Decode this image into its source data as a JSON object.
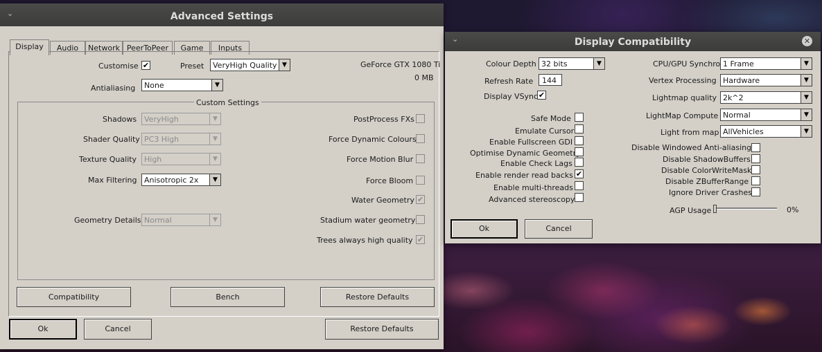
{
  "adv": {
    "title": "Advanced Settings",
    "tabs": [
      "Display",
      "Audio",
      "Network",
      "PeerToPeer",
      "Game",
      "Inputs"
    ],
    "gpu_name": "GeForce GTX 1080 Ti",
    "gpu_mem": "0 MB",
    "customise_label": "Customise",
    "customise_checked": "✔",
    "preset_label": "Preset",
    "preset_value": "VeryHigh Quality",
    "aa_label": "Antialiasing",
    "aa_value": "None",
    "group_title": "Custom Settings",
    "shadows_label": "Shadows",
    "shadows_value": "VeryHigh",
    "shader_label": "Shader Quality",
    "shader_value": "PC3 High",
    "texture_label": "Texture Quality",
    "texture_value": "High",
    "maxfilter_label": "Max Filtering",
    "maxfilter_value": "Anisotropic  2x",
    "geometry_label": "Geometry Details",
    "geometry_value": "Normal",
    "postfx_label": "PostProcess FXs",
    "dyncol_label": "Force Dynamic Colours",
    "motionblur_label": "Force Motion Blur",
    "bloom_label": "Force Bloom",
    "water_label": "Water Geometry",
    "water_checked": "✔",
    "stadium_label": "Stadium water geometry",
    "trees_label": "Trees always high quality",
    "trees_checked": "✔",
    "btn_compat": "Compatibility",
    "btn_bench": "Bench",
    "btn_restore_inner": "Restore Defaults",
    "btn_ok": "Ok",
    "btn_cancel": "Cancel",
    "btn_restore": "Restore Defaults"
  },
  "compat": {
    "title": "Display Compatibility",
    "colour_depth_label": "Colour Depth",
    "colour_depth_value": "32 bits",
    "refresh_label": "Refresh Rate",
    "refresh_value": "144",
    "vsync_label": "Display VSync",
    "vsync_checked": "✔",
    "safe_mode": "Safe Mode",
    "emulate_cursor": "Emulate Cursor",
    "fullscreen_gdi": "Enable Fullscreen GDI",
    "opt_dyn_geom": "Optimise Dynamic Geometry",
    "check_lags": "Enable Check Lags",
    "render_readbacks": "Enable render read backs",
    "render_readbacks_checked": "✔",
    "multithreads": "Enable multi-threads",
    "adv_stereo": "Advanced stereoscopy",
    "cpu_gpu_label": "CPU/GPU Synchro",
    "cpu_gpu_value": "1 Frame",
    "vertex_label": "Vertex Processing",
    "vertex_value": "Hardware",
    "lightmap_q_label": "Lightmap quality",
    "lightmap_q_value": "2k^2",
    "lightmap_compute_label": "LightMap Compute",
    "lightmap_compute_value": "Normal",
    "light_from_map_label": "Light from map",
    "light_from_map_value": "AllVehicles",
    "win_aa": "Disable Windowed Anti-aliasing",
    "shadowbuffers": "Disable ShadowBuffers",
    "colorwritemask": "Disable ColorWriteMask",
    "zbufferrange": "Disable ZBufferRange",
    "driver_crashes": "Ignore Driver Crashes",
    "agp_label": "AGP Usage",
    "agp_value": "0%",
    "agp_level": 0,
    "btn_ok": "Ok",
    "btn_cancel": "Cancel"
  }
}
